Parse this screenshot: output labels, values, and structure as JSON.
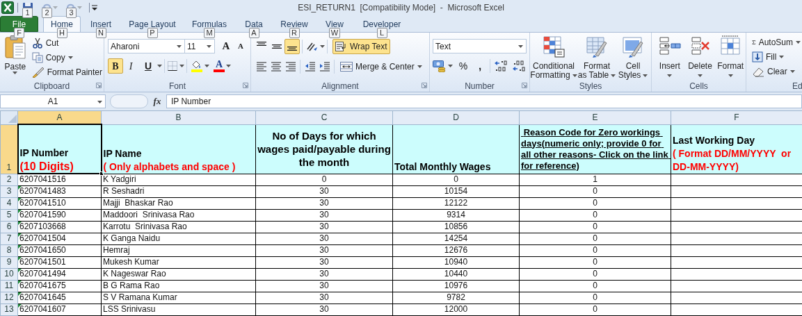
{
  "title_bar": {
    "title": "ESI_RETURN1  [Compatibility Mode]  -  Microsoft Excel",
    "quick_access": [
      {
        "kind": "save",
        "key_tip": "1",
        "disabled": false
      },
      {
        "kind": "undo",
        "key_tip": "2",
        "disabled": true
      },
      {
        "kind": "redo",
        "key_tip": "3",
        "disabled": true
      }
    ]
  },
  "tabs": [
    {
      "kind": "file",
      "label": "File",
      "key_tip": "F",
      "selected": false
    },
    {
      "kind": "tab",
      "label": "Home",
      "key_tip": "H",
      "selected": true
    },
    {
      "kind": "tab",
      "label": "Insert",
      "key_tip": "N",
      "selected": false
    },
    {
      "kind": "tab",
      "label": "Page Layout",
      "key_tip": "P",
      "selected": false
    },
    {
      "kind": "tab",
      "label": "Formulas",
      "key_tip": "M",
      "selected": false
    },
    {
      "kind": "tab",
      "label": "Data",
      "key_tip": "A",
      "selected": false
    },
    {
      "kind": "tab",
      "label": "Review",
      "key_tip": "R",
      "selected": false
    },
    {
      "kind": "tab",
      "label": "View",
      "key_tip": "W",
      "selected": false
    },
    {
      "kind": "tab",
      "label": "Developer",
      "key_tip": "L",
      "selected": false
    }
  ],
  "ribbon": {
    "clipboard": {
      "label": "Clipboard",
      "paste": "Paste",
      "cut": "Cut",
      "copy": "Copy",
      "format_painter": "Format Painter"
    },
    "font": {
      "label": "Font",
      "font_name": "Aharoni",
      "font_size": "11",
      "grow": "A",
      "shrink": "A",
      "font_color": "A",
      "toggles": [
        {
          "kind": "bold",
          "label": "B",
          "active": true
        },
        {
          "kind": "italic",
          "label": "I",
          "active": false
        },
        {
          "kind": "underline",
          "label": "U",
          "active": false
        }
      ]
    },
    "alignment": {
      "label": "Alignment",
      "vertical": [
        {
          "kind": "top",
          "active": false
        },
        {
          "kind": "middle",
          "active": false
        },
        {
          "kind": "bottom",
          "active": true
        }
      ],
      "wrap_text": {
        "label": "Wrap Text",
        "active": true
      },
      "merge": "Merge & Center"
    },
    "number": {
      "label": "Number",
      "format": "Text",
      "percent": "%",
      "comma": ","
    },
    "styles": {
      "label": "Styles",
      "buttons": [
        {
          "kind": "conditional",
          "lines": [
            "Conditional",
            "Formatting"
          ]
        },
        {
          "kind": "table",
          "lines": [
            "Format",
            "as Table"
          ]
        },
        {
          "kind": "cell_styles",
          "lines": [
            "Cell",
            "Styles"
          ]
        }
      ]
    },
    "cells": {
      "label": "Cells",
      "buttons": [
        {
          "kind": "insert",
          "label": "Insert"
        },
        {
          "kind": "delete",
          "label": "Delete"
        },
        {
          "kind": "format",
          "label": "Format"
        }
      ]
    },
    "editing": {
      "label": "Ed",
      "buttons": [
        {
          "kind": "autosum",
          "label": "AutoSum"
        },
        {
          "kind": "fill",
          "label": "Fill"
        },
        {
          "kind": "clear",
          "label": "Clear"
        }
      ]
    }
  },
  "formula_bar": {
    "name_box": "A1",
    "fx": "fx",
    "formula": "IP Number"
  },
  "sheet": {
    "columns": [
      {
        "label": "A",
        "selected": true
      },
      {
        "label": "B",
        "selected": false
      },
      {
        "label": "C",
        "selected": false
      },
      {
        "label": "D",
        "selected": false
      },
      {
        "label": "E",
        "selected": false
      },
      {
        "label": "F",
        "selected": false
      }
    ],
    "header_row": {
      "row_number": "1",
      "selected": true,
      "cells": [
        {
          "title": "IP Number",
          "note": "(10 Digits)",
          "underlined": false
        },
        {
          "title": "IP Name",
          "note": "( Only alphabets and space )",
          "underlined": false
        },
        {
          "title": "No of Days for which wages paid/payable during the month",
          "underlined": false
        },
        {
          "title": "Total Monthly Wages",
          "underlined": false
        },
        {
          "title": " Reason Code for Zero workings days(numeric only; provide 0 for all other reasons- Click on the link for reference)",
          "underlined": true
        },
        {
          "title": "Last Working Day",
          "note": "( Format DD/MM/YYYY  or DD-MM-YYYY)",
          "underlined": false
        }
      ]
    },
    "rows": [
      {
        "row_number": "2",
        "error_flag": false,
        "ip": "6207041516",
        "name": "K Yadgiri",
        "days": "0",
        "wages": "0",
        "reason": "1"
      },
      {
        "row_number": "3",
        "error_flag": true,
        "ip": "6207041483",
        "name": "R Seshadri",
        "days": "30",
        "wages": "10154",
        "reason": "0"
      },
      {
        "row_number": "4",
        "error_flag": true,
        "ip": "6207041510",
        "name": "Majji  Bhaskar Rao",
        "days": "30",
        "wages": "12122",
        "reason": "0"
      },
      {
        "row_number": "5",
        "error_flag": true,
        "ip": "6207041590",
        "name": "Maddoori  Srinivasa Rao",
        "days": "30",
        "wages": "9314",
        "reason": "0"
      },
      {
        "row_number": "6",
        "error_flag": true,
        "ip": "6207103668",
        "name": "Karrotu  Srinivasa Rao",
        "days": "30",
        "wages": "10856",
        "reason": "0"
      },
      {
        "row_number": "7",
        "error_flag": true,
        "ip": "6207041504",
        "name": "K Ganga Naidu",
        "days": "30",
        "wages": "14254",
        "reason": "0"
      },
      {
        "row_number": "8",
        "error_flag": true,
        "ip": "6207041650",
        "name": "Hemraj",
        "days": "30",
        "wages": "12676",
        "reason": "0"
      },
      {
        "row_number": "9",
        "error_flag": true,
        "ip": "6207041501",
        "name": "Mukesh Kumar",
        "days": "30",
        "wages": "10940",
        "reason": "0"
      },
      {
        "row_number": "10",
        "error_flag": true,
        "ip": "6207041494",
        "name": "K Nageswar Rao",
        "days": "30",
        "wages": "10440",
        "reason": "0"
      },
      {
        "row_number": "11",
        "error_flag": true,
        "ip": "6207041675",
        "name": "B G Rama Rao",
        "days": "30",
        "wages": "10976",
        "reason": "0"
      },
      {
        "row_number": "12",
        "error_flag": true,
        "ip": "6207041645",
        "name": "S V Ramana Kumar",
        "days": "30",
        "wages": "9782",
        "reason": "0"
      },
      {
        "row_number": "13",
        "error_flag": true,
        "ip": "6207041607",
        "name": "LSS Srinivasu",
        "days": "30",
        "wages": "12000",
        "reason": "0"
      }
    ]
  }
}
